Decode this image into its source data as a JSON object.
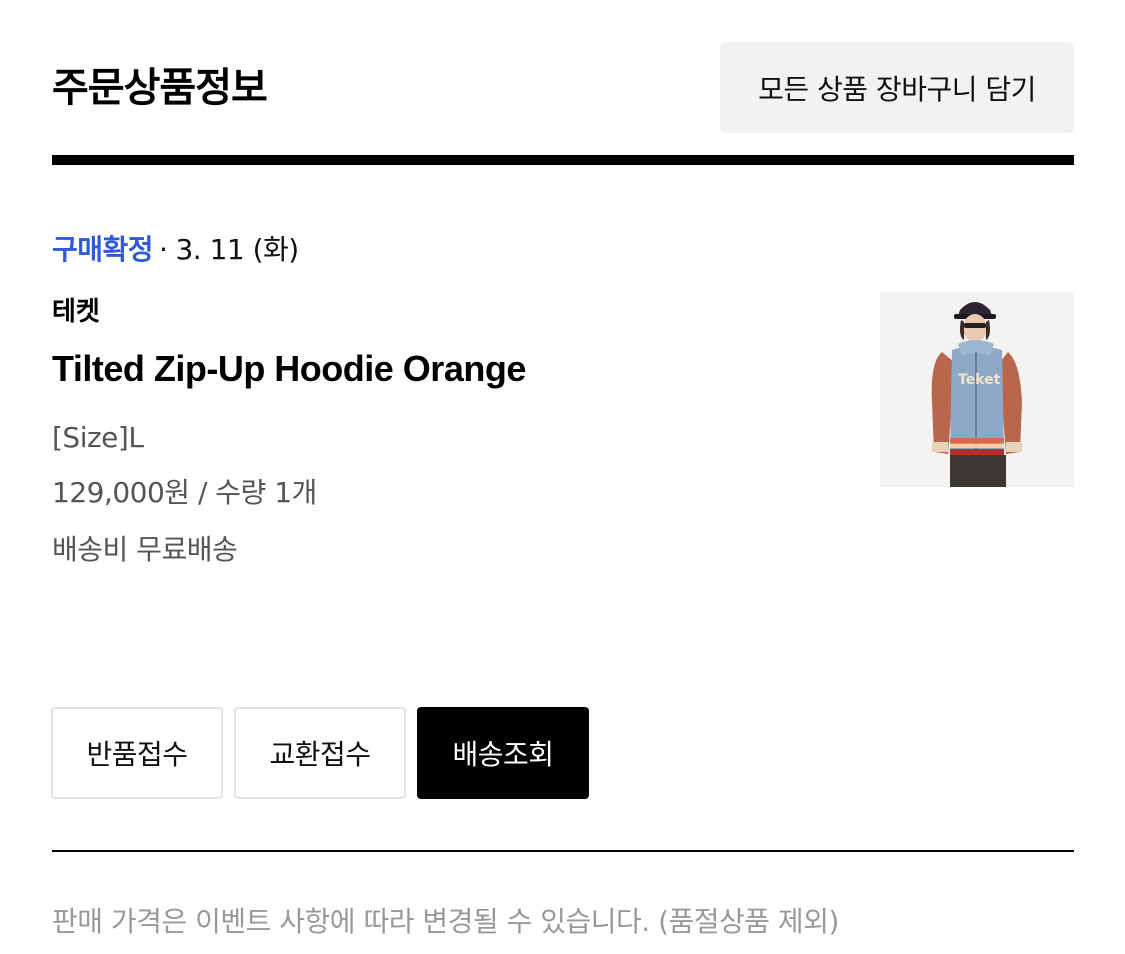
{
  "header": {
    "title": "주문상품정보",
    "add_all_label": "모든 상품 장바구니 담기"
  },
  "order": {
    "status": "구매확정",
    "separator": "·",
    "date": "3. 11 (화)",
    "brand": "테켓",
    "product_name": "Tilted Zip-Up Hoodie Orange",
    "option": "[Size]L",
    "price_qty": "129,000원 / 수량 1개",
    "shipping": "배송비 무료배송",
    "thumbnail_icon": "hoodie-product-photo"
  },
  "actions": {
    "return_label": "반품접수",
    "exchange_label": "교환접수",
    "track_label": "배송조회"
  },
  "footer": {
    "note": "판매 가격은 이벤트 사항에 따라 변경될 수 있습니다. (품절상품 제외)"
  },
  "colors": {
    "status_accent": "#2f5bd9",
    "primary_button": "#000000",
    "secondary_button_bg": "#f2f2f2",
    "muted_text": "#999999"
  }
}
